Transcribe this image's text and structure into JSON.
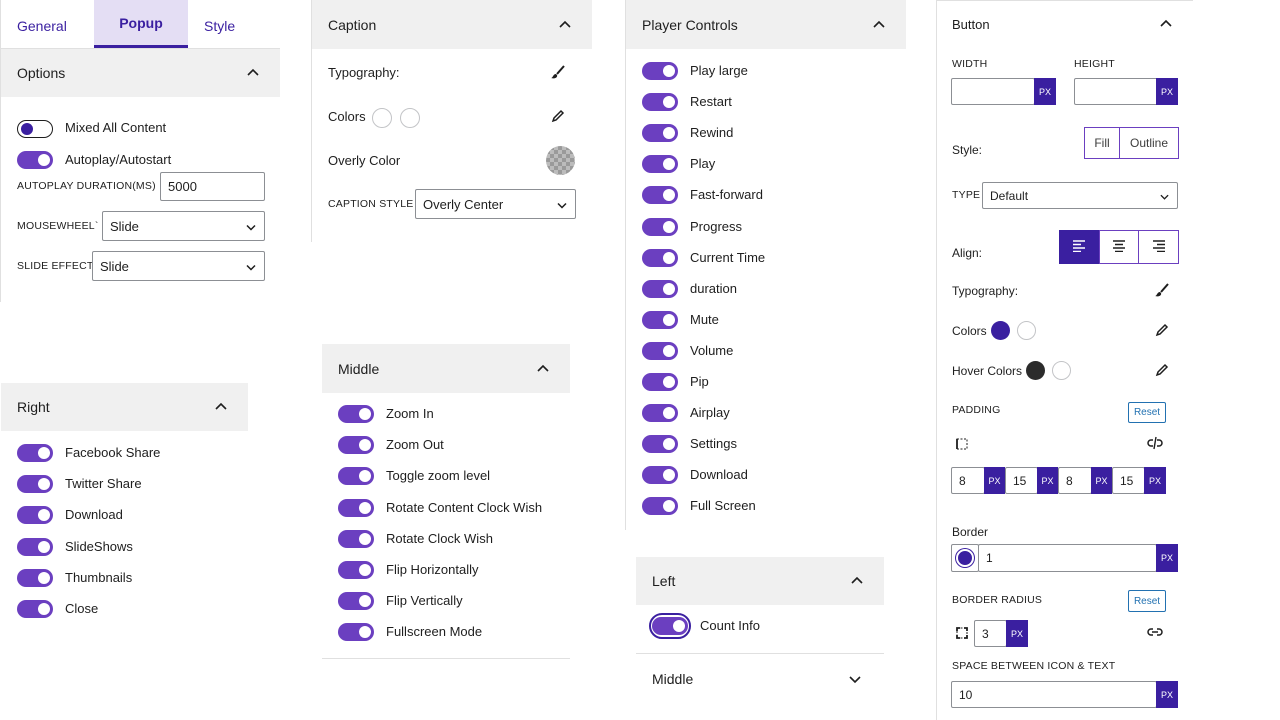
{
  "tabs": {
    "general": "General",
    "popup": "Popup",
    "style": "Style"
  },
  "options": {
    "title": "Options",
    "mixed_all_content": "Mixed All Content",
    "autoplay": "Autoplay/Autostart",
    "autoplay_duration_label": "AUTOPLAY DURATION(MS)",
    "autoplay_duration_value": "5000",
    "mousewheel_label": "MOUSEWHEEL`",
    "mousewheel_value": "Slide",
    "slide_effect_label": "SLIDE EFFECT",
    "slide_effect_value": "Slide"
  },
  "right": {
    "title": "Right",
    "items": [
      "Facebook Share",
      "Twitter Share",
      "Download",
      "SlideShows",
      "Thumbnails",
      "Close"
    ]
  },
  "caption": {
    "title": "Caption",
    "typography": "Typography:",
    "colors": "Colors",
    "overly_color": "Overly Color",
    "caption_style_label": "CAPTION STYLE",
    "caption_style_value": "Overly Center"
  },
  "middle": {
    "title": "Middle",
    "items": [
      "Zoom In",
      "Zoom Out",
      "Toggle zoom level",
      "Rotate Content Clock Wish",
      "Rotate Clock Wish",
      "Flip Horizontally",
      "Flip Vertically",
      "Fullscreen Mode"
    ]
  },
  "player_controls": {
    "title": "Player Controls",
    "items": [
      "Play large",
      "Restart",
      "Rewind",
      "Play",
      "Fast-forward",
      "Progress",
      "Current Time",
      "duration",
      "Mute",
      "Volume",
      "Pip",
      "Airplay",
      "Settings",
      "Download",
      "Full Screen"
    ]
  },
  "left": {
    "title": "Left",
    "count_info": "Count Info"
  },
  "middle2": {
    "title": "Middle"
  },
  "button": {
    "title": "Button",
    "width_label": "WIDTH",
    "height_label": "HEIGHT",
    "px": "PX",
    "style_label": "Style:",
    "fill": "Fill",
    "outline": "Outline",
    "type_label": "TYPE",
    "type_value": "Default",
    "align_label": "Align:",
    "typography": "Typography:",
    "colors": "Colors",
    "hover_colors": "Hover Colors",
    "padding_label": "PADDING",
    "reset": "Reset",
    "padding_values": [
      "8",
      "15",
      "8",
      "15"
    ],
    "border_label": "Border",
    "border_value": "1",
    "border_radius_label": "BORDER RADIUS",
    "border_radius_value": "3",
    "space_label": "SPACE BETWEEN ICON & TEXT",
    "space_value": "10"
  },
  "colors": {
    "accent": "#6b3fc0",
    "accent_dark": "#3a1fa0",
    "header_bg": "#f0f0f0",
    "dark_swatch": "#2b2b2b"
  }
}
